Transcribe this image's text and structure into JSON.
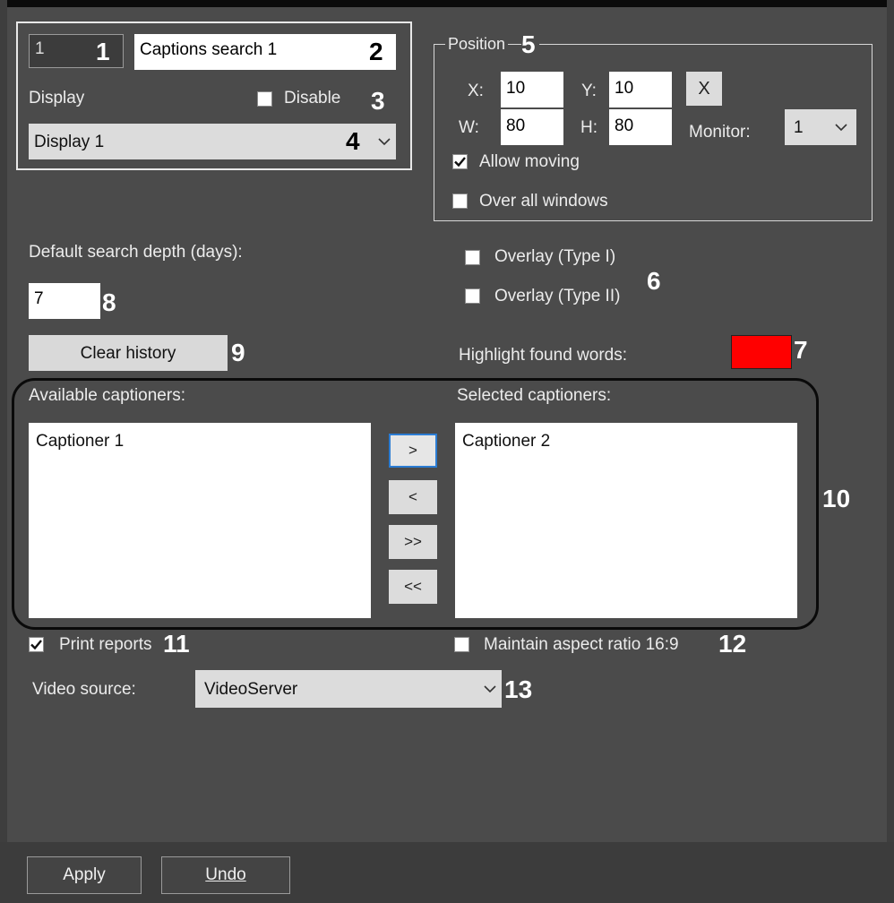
{
  "identity": {
    "id_value": "1",
    "name_value": "Captions search 1"
  },
  "display": {
    "label": "Display",
    "disable_label": "Disable",
    "disable_checked": false,
    "selected": "Display 1"
  },
  "position": {
    "legend": "Position",
    "x_label": "X:",
    "x_value": "10",
    "y_label": "Y:",
    "y_value": "10",
    "w_label": "W:",
    "w_value": "80",
    "h_label": "H:",
    "h_value": "80",
    "reset_label": "X",
    "monitor_label": "Monitor:",
    "monitor_value": "1",
    "allow_moving_label": "Allow moving",
    "allow_moving_checked": true,
    "over_all_windows_label": "Over all windows",
    "over_all_windows_checked": false
  },
  "search": {
    "depth_label": "Default search depth (days):",
    "depth_value": "7",
    "clear_history_label": "Clear history"
  },
  "overlay": {
    "type1_label": "Overlay (Type I)",
    "type1_checked": false,
    "type2_label": "Overlay (Type II)",
    "type2_checked": false
  },
  "highlight": {
    "label": "Highlight found words:",
    "color": "#ff0000"
  },
  "captioners": {
    "available_label": "Available captioners:",
    "selected_label": "Selected captioners:",
    "available_items": [
      "Captioner 1"
    ],
    "selected_items": [
      "Captioner 2"
    ],
    "move_right": ">",
    "move_left": "<",
    "move_all_right": ">>",
    "move_all_left": "<<"
  },
  "print_reports": {
    "label": "Print reports",
    "checked": true
  },
  "aspect": {
    "label": "Maintain aspect ratio 16:9",
    "checked": false
  },
  "video_source": {
    "label": "Video source:",
    "value": "VideoServer"
  },
  "footer": {
    "apply_label": "Apply",
    "undo_label": "Undo"
  },
  "callouts": [
    "1",
    "2",
    "3",
    "4",
    "5",
    "6",
    "7",
    "8",
    "9",
    "10",
    "11",
    "12",
    "13"
  ]
}
